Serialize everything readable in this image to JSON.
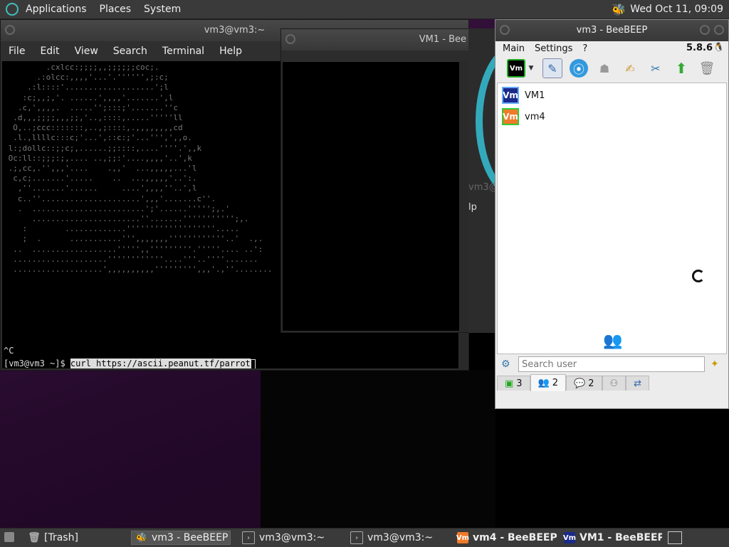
{
  "top_panel": {
    "menus": [
      "Applications",
      "Places",
      "System"
    ],
    "clock": "Wed Oct 11, 09:09"
  },
  "terminal_main": {
    "title": "vm3@vm3:~",
    "menu": [
      "File",
      "Edit",
      "View",
      "Search",
      "Terminal",
      "Help"
    ],
    "ascii_art": "         .cxlcc:;;;;,,;;;;;;coc;.\n       .:olcc:,,,,'...'.'''''',;:c;\n     .:l::::'...................';l\n    :c;,,;,'. ......',,,,'.......',l\n   .c,',,,,.  .....'';:::;'.......''c\n  .d,,,;;;;,,,;;,'..,::::,.....'''''ll\n  O,..;ccc:::::::,..,;::::,.,,,,,,,,cd\n  .l.,llllc:::c;'...',::c:;'...''',',,o.\n l:;dollc::;;c;,......;;::::,....''''.',,k\n Oc:ll::;;;:;,.... ..,;;:'....,,,,'..',k\n .;,cc,.'',,,'....    .,,'  ...,,,,,...'l\n  c,c;.......'.....    ..  ...,,,,,'..':.\n   ,''.......'......     ....',,,,''..',l\n   c..''.....................',,,'.......c''.\n   .  ........................';'......''''';,.'\n      .......................''.......''''''''''';,.\n    :        .............'''''''''''''''''''.....\n    ;  .      ...........''',,,,,,,''''''''''''..'  .,.\n  ..  ..................''''',,'''''''''.'''''.... ..':\n  ....................''''''''''''....'''..''''.......\n  ...................',,,,,,,,,,''''''''',,,'.,''........",
    "ctrl_c": "^C",
    "prompt": "[vm3@vm3 ~]$ ",
    "command": "curl https://ascii.peanut.tf/parrot"
  },
  "terminal_second": {
    "title": "VM1 - Bee"
  },
  "background_window": {
    "title_fragment": "vm3@",
    "menu_fragment": "lp"
  },
  "beebeep": {
    "title": "vm3 - BeeBEEP",
    "menu": [
      "Main",
      "Settings",
      "?"
    ],
    "version": "5.8.6",
    "users": [
      {
        "name": "VM1",
        "badge": "Vm",
        "color": "#1a2a8a"
      },
      {
        "name": "vm4",
        "badge": "Vm",
        "color": "#f07a2a"
      }
    ],
    "search_placeholder": "Search user",
    "tabs": [
      {
        "icon": "users-online-icon",
        "count": "3"
      },
      {
        "icon": "group-icon",
        "count": "2"
      },
      {
        "icon": "chat-icon",
        "count": "2"
      },
      {
        "icon": "groups-icon",
        "count": ""
      },
      {
        "icon": "share-icon",
        "count": ""
      }
    ]
  },
  "taskbar": {
    "items": [
      {
        "label": "[Trash]",
        "icon": "trash-icon"
      },
      {
        "label": "vm3 - BeeBEEP",
        "icon": "beebeep-icon"
      },
      {
        "label": "vm3@vm3:~",
        "icon": "terminal-icon"
      },
      {
        "label": "vm3@vm3:~",
        "icon": "terminal-icon"
      },
      {
        "label": "vm4 - BeeBEEP ...",
        "icon": "vm-icon"
      },
      {
        "label": "VM1 - BeeBEEP ...",
        "icon": "vm-icon"
      }
    ]
  },
  "colors": {
    "panel": "#3a3a3a",
    "desktop": "#2a0f2e",
    "terminal_bg": "#000000",
    "vm1_badge": "#1a2a8a",
    "vm4_badge": "#f07a2a"
  }
}
